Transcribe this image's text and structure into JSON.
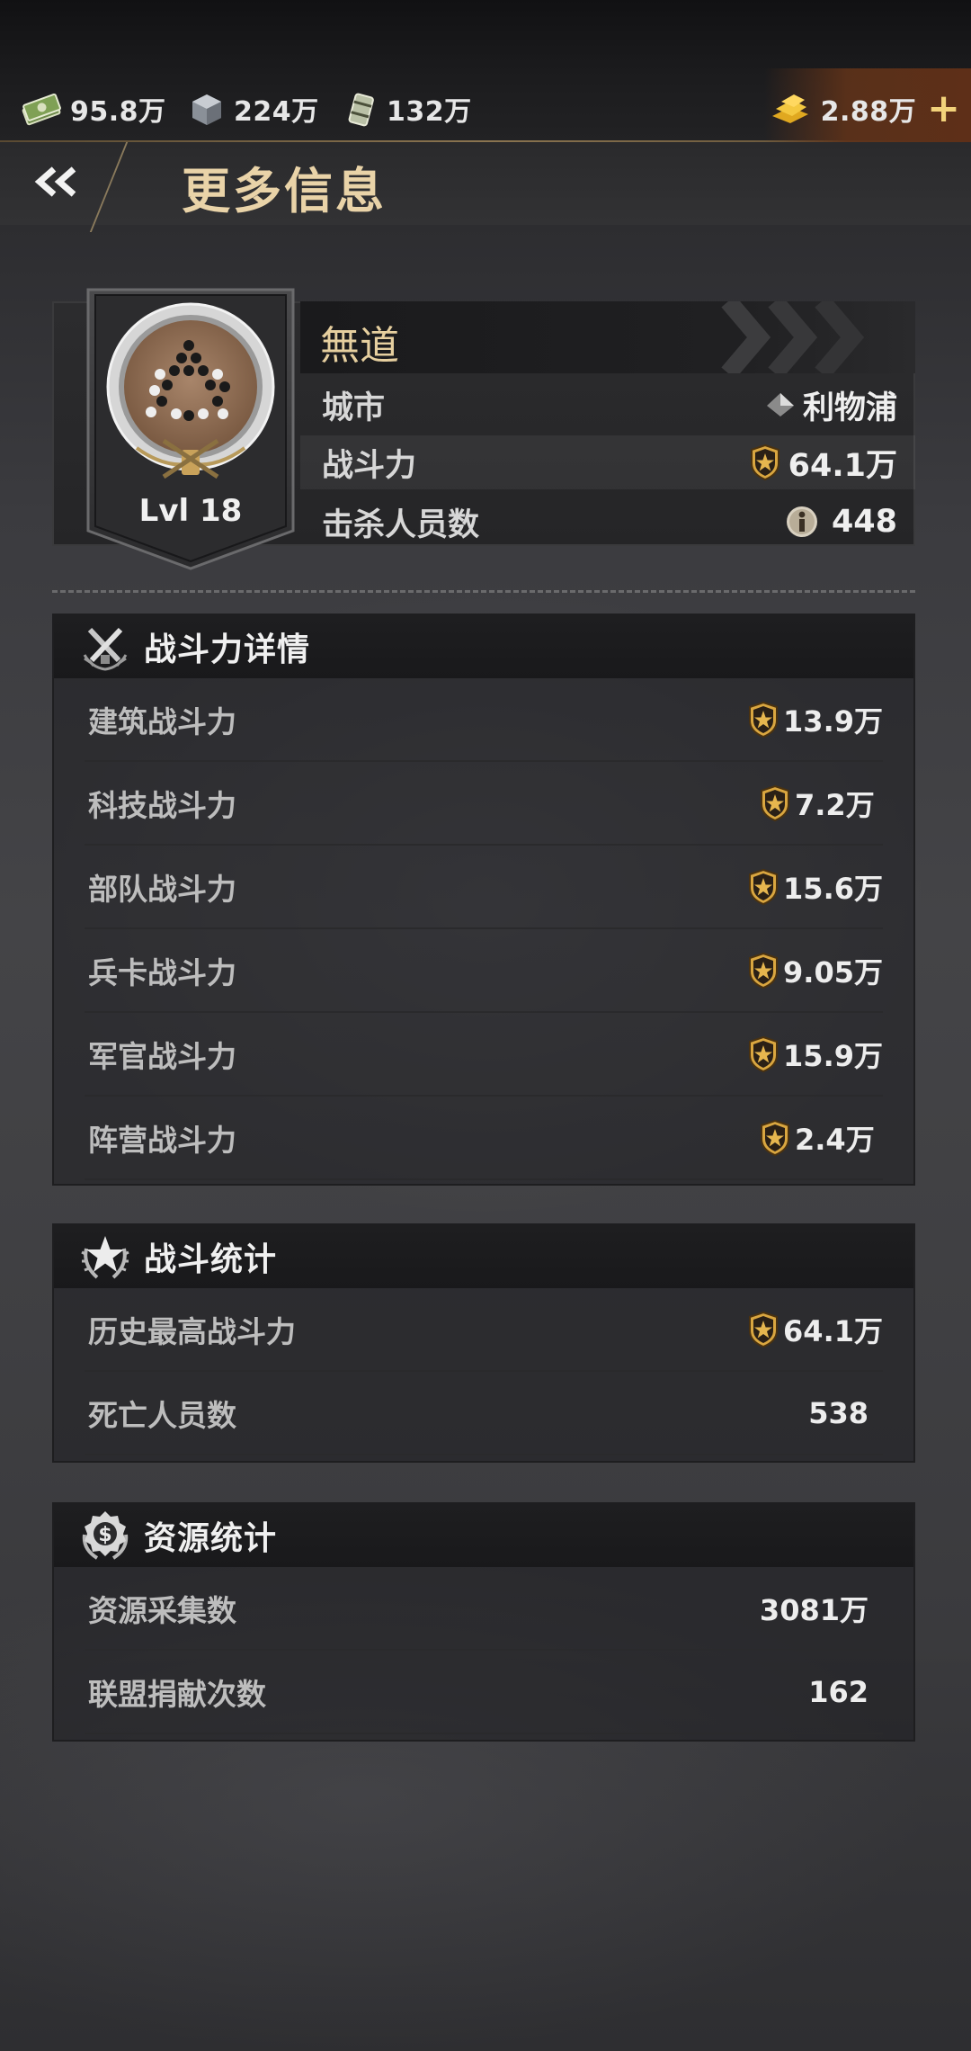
{
  "resources": {
    "cash": "95.8万",
    "steel": "224万",
    "oil": "132万",
    "gold": "2.88万",
    "add_label": "+"
  },
  "header": {
    "title": "更多信息",
    "back_label": "«"
  },
  "profile": {
    "name": "無道",
    "level": "Lvl 18",
    "city_label": "城市",
    "city_value": "利物浦",
    "power_label": "战斗力",
    "power_value": "64.1万",
    "kills_label": "击杀人员数",
    "kills_value": "448"
  },
  "power_details": {
    "title": "战斗力详情",
    "rows": [
      {
        "label": "建筑战斗力",
        "value": "13.9万"
      },
      {
        "label": "科技战斗力",
        "value": "7.2万"
      },
      {
        "label": "部队战斗力",
        "value": "15.6万"
      },
      {
        "label": "兵卡战斗力",
        "value": "9.05万"
      },
      {
        "label": "军官战斗力",
        "value": "15.9万"
      },
      {
        "label": "阵营战斗力",
        "value": "2.4万"
      }
    ]
  },
  "battle_stats": {
    "title": "战斗统计",
    "rows": [
      {
        "label": "历史最高战斗力",
        "value": "64.1万"
      },
      {
        "label": "死亡人员数",
        "value": "538"
      }
    ]
  },
  "resource_stats": {
    "title": "资源统计",
    "rows": [
      {
        "label": "资源采集数",
        "value": "3081万"
      },
      {
        "label": "联盟捐献次数",
        "value": "162"
      }
    ]
  },
  "colors": {
    "accent_gold": "#e9d3a8",
    "shield_gold": "#d9a640",
    "panel": "#252527"
  }
}
